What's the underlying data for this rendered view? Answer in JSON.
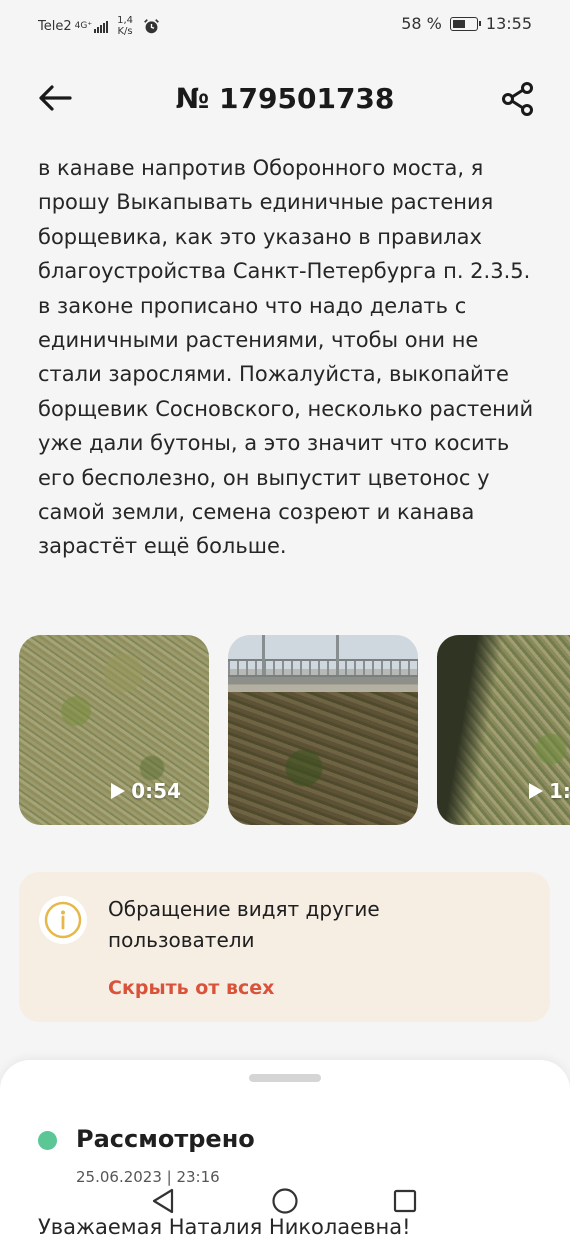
{
  "status_bar": {
    "carrier": "Tele2",
    "network": "4G⁺",
    "speed_value": "1,4",
    "speed_unit": "K/s",
    "battery_percent": "58 %",
    "battery_level": 0.58,
    "time": "13:55"
  },
  "header": {
    "title": "№ 179501738"
  },
  "description": "в канаве напротив Оборонного моста, я прошу Выкапывать единичные растения борщевика, как это указано в правилах благоустройства Санкт-Петербурга п. 2.3.5. в законе прописано что надо делать с единичными растениями, чтобы они не стали зарослями. Пожалуйста, выкопайте борщевик Сосновского, несколько растений уже дали бутоны, а это значит что косить его бесполезно, он выпустит цветонос у самой земли, семена созреют и канава зарастёт ещё больше.",
  "media": [
    {
      "type": "video",
      "duration": "0:54"
    },
    {
      "type": "photo"
    },
    {
      "type": "video",
      "duration": "1:"
    }
  ],
  "notice": {
    "text": "Обращение видят другие пользователи",
    "link": "Скрыть от всех"
  },
  "status": {
    "label": "Рассмотрено",
    "date": "25.06.2023 | 23:16",
    "color": "#5cc796"
  },
  "reply_preview": "Уважаемая Наталия Николаевна!",
  "colors": {
    "accent_link": "#d9533a",
    "notice_bg": "#f6ede3",
    "info_icon": "#e6b84a"
  }
}
